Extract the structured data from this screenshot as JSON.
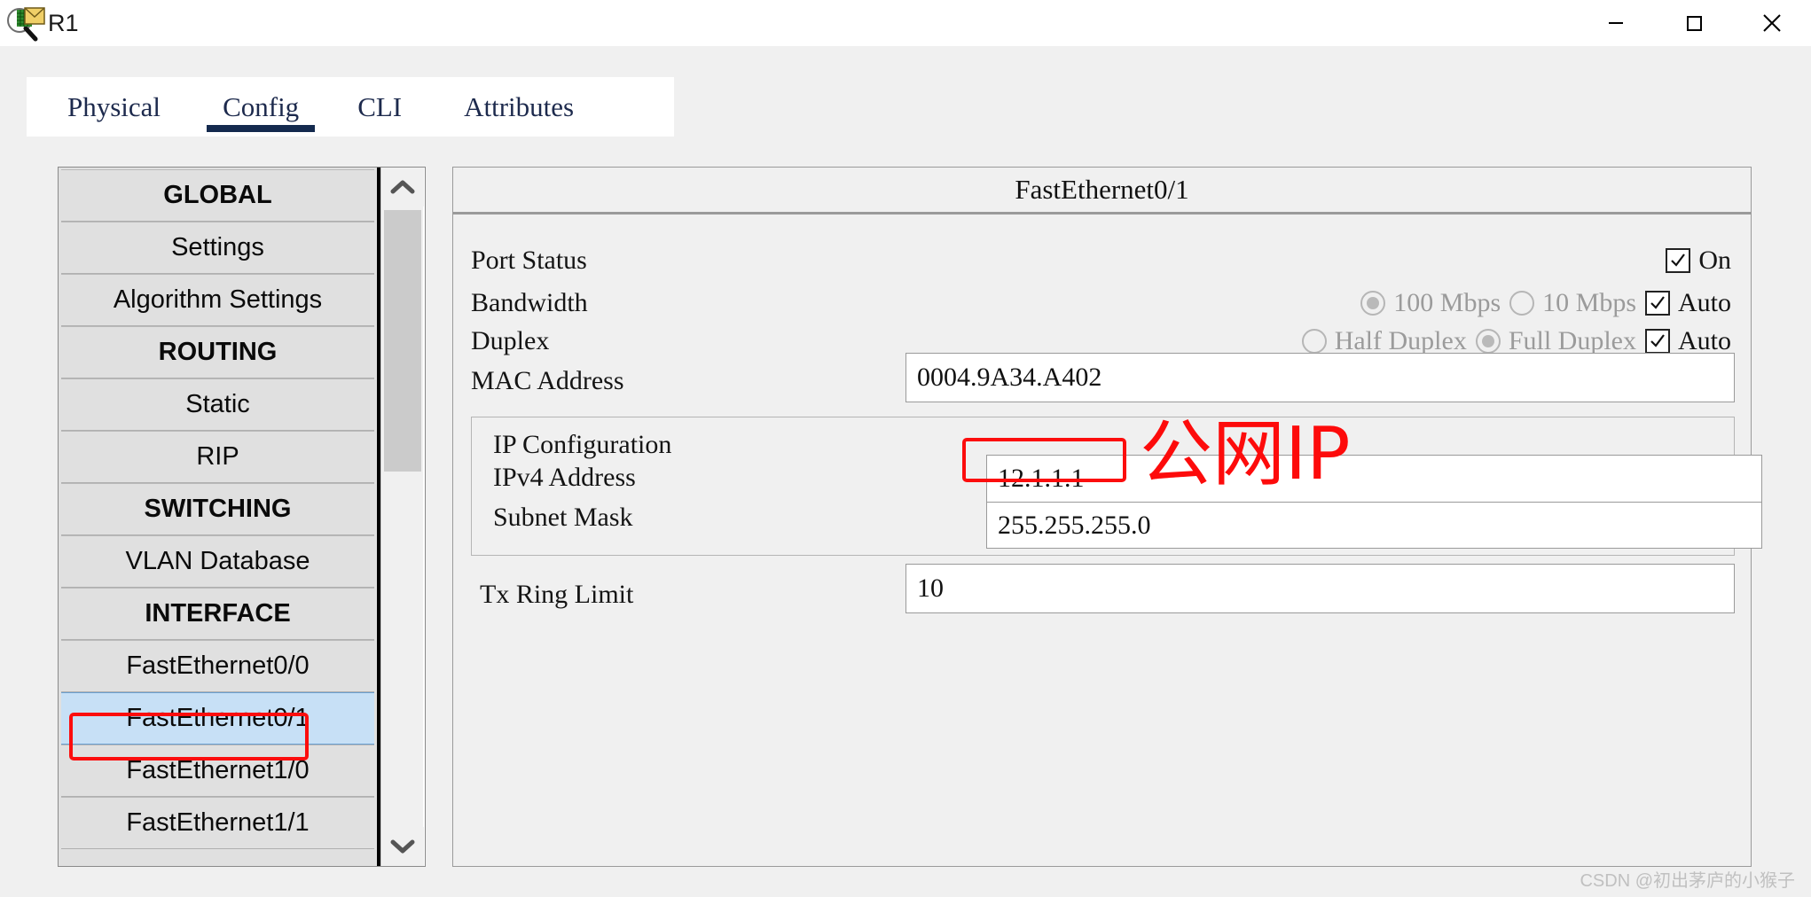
{
  "window": {
    "title": "R1",
    "icon": "inspect-magnifier-icon",
    "minimize": "—",
    "maximize": "□",
    "close": "✕"
  },
  "tabs": [
    {
      "label": "Physical",
      "active": false
    },
    {
      "label": "Config",
      "active": true
    },
    {
      "label": "CLI",
      "active": false
    },
    {
      "label": "Attributes",
      "active": false
    }
  ],
  "sidebar": {
    "items": [
      {
        "label": "GLOBAL",
        "type": "header"
      },
      {
        "label": "Settings",
        "type": "item"
      },
      {
        "label": "Algorithm Settings",
        "type": "item"
      },
      {
        "label": "ROUTING",
        "type": "header"
      },
      {
        "label": "Static",
        "type": "item"
      },
      {
        "label": "RIP",
        "type": "item"
      },
      {
        "label": "SWITCHING",
        "type": "header"
      },
      {
        "label": "VLAN Database",
        "type": "item"
      },
      {
        "label": "INTERFACE",
        "type": "header"
      },
      {
        "label": "FastEthernet0/0",
        "type": "item"
      },
      {
        "label": "FastEthernet0/1",
        "type": "item",
        "selected": true
      },
      {
        "label": "FastEthernet1/0",
        "type": "item"
      },
      {
        "label": "FastEthernet1/1",
        "type": "item"
      }
    ],
    "scroll_up": "▲",
    "scroll_down": "▼"
  },
  "panel": {
    "title": "FastEthernet0/1",
    "port_status": {
      "label": "Port Status",
      "on_label": "On",
      "checked": true
    },
    "bandwidth": {
      "label": "Bandwidth",
      "options": [
        {
          "label": "100 Mbps",
          "selected": true
        },
        {
          "label": "10 Mbps",
          "selected": false
        }
      ],
      "auto_label": "Auto",
      "auto_checked": true
    },
    "duplex": {
      "label": "Duplex",
      "options": [
        {
          "label": "Half Duplex",
          "selected": false
        },
        {
          "label": "Full Duplex",
          "selected": true
        }
      ],
      "auto_label": "Auto",
      "auto_checked": true
    },
    "mac": {
      "label": "MAC Address",
      "value": "0004.9A34.A402"
    },
    "ip_config": {
      "group_label": "IP Configuration",
      "ipv4_label": "IPv4 Address",
      "ipv4_value": "12.1.1.1",
      "subnet_label": "Subnet Mask",
      "subnet_value": "255.255.255.0"
    },
    "tx_ring": {
      "label": "Tx Ring Limit",
      "value": "10"
    }
  },
  "annotations": {
    "public_ip_text": "公网IP",
    "accent_color": "#fd0b0b"
  },
  "watermark": "CSDN @初出茅庐的小猴子"
}
